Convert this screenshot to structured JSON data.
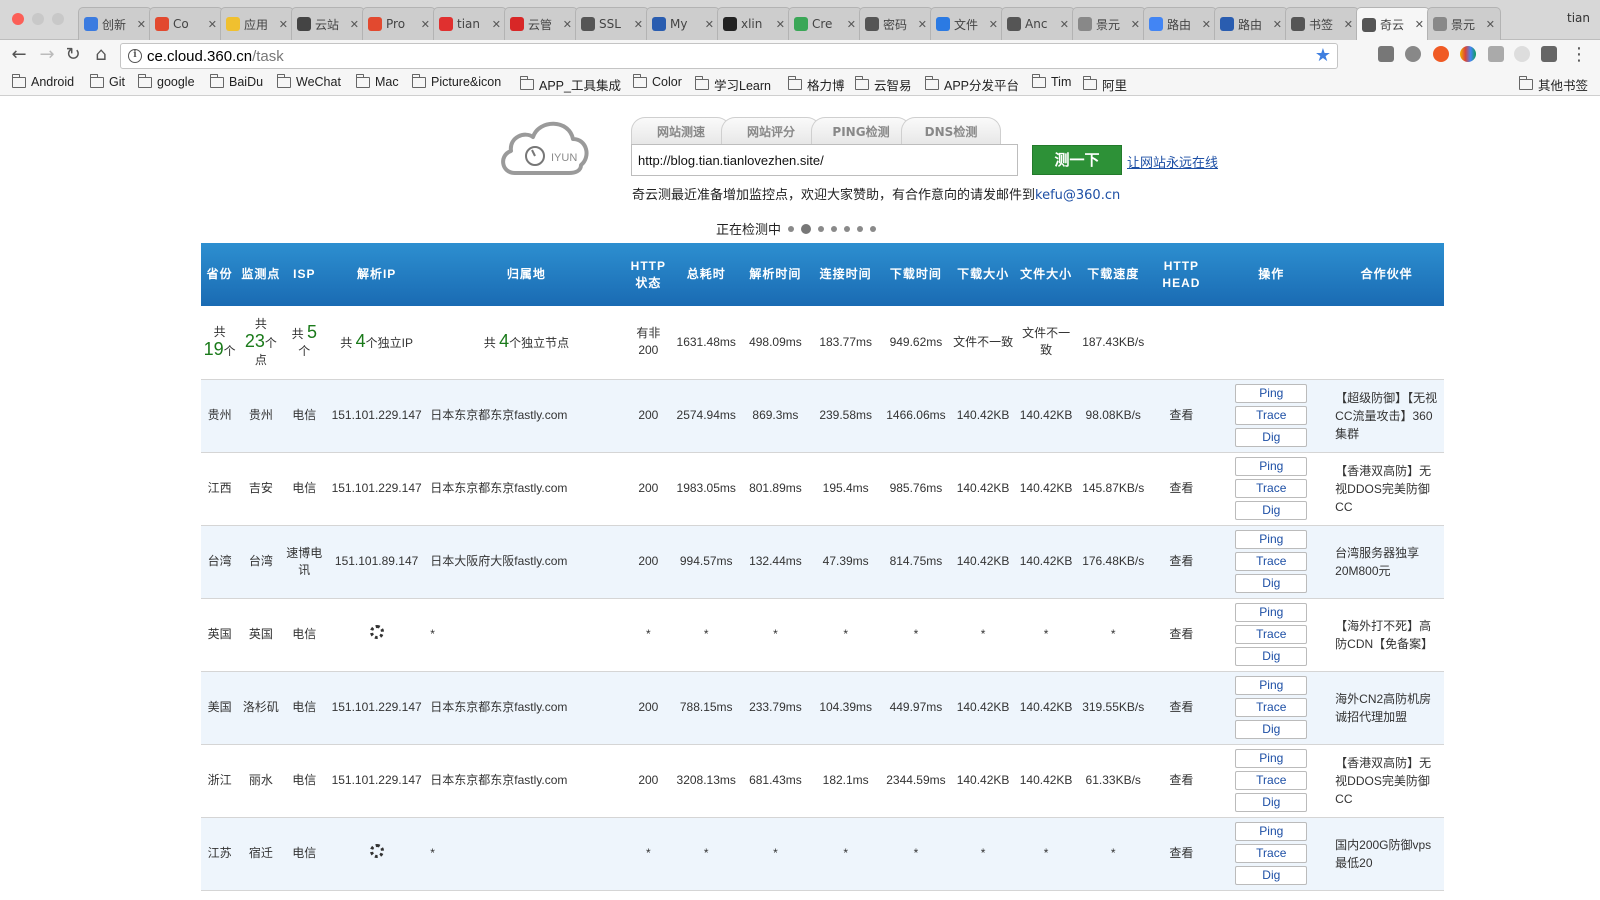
{
  "browser": {
    "tabs": [
      {
        "label": "创新",
        "color": "#3b7be0"
      },
      {
        "label": "Co",
        "color": "#e2492f"
      },
      {
        "label": "应用",
        "color": "#f0c02f"
      },
      {
        "label": "云站",
        "color": "#444444"
      },
      {
        "label": "Pro",
        "color": "#e2492f"
      },
      {
        "label": "tian",
        "color": "#e0302f"
      },
      {
        "label": "云管",
        "color": "#d82727"
      },
      {
        "label": "SSL",
        "color": "#555555"
      },
      {
        "label": "My",
        "color": "#2a5db0"
      },
      {
        "label": "xlin",
        "color": "#222222"
      },
      {
        "label": "Cre",
        "color": "#3aa757"
      },
      {
        "label": "密码",
        "color": "#555555"
      },
      {
        "label": "文件",
        "color": "#2b7ae3"
      },
      {
        "label": "Anc",
        "color": "#555555"
      },
      {
        "label": "景元",
        "color": "#888888"
      },
      {
        "label": "路由",
        "color": "#4285f4"
      },
      {
        "label": "路由",
        "color": "#2a5db0"
      },
      {
        "label": "书签",
        "color": "#555555"
      },
      {
        "label": "奇云",
        "color": "#555555"
      },
      {
        "label": "景元",
        "color": "#888888"
      }
    ],
    "active_tab_index": 18,
    "profile_name": "tian",
    "url_host": "ce.cloud.360.cn",
    "url_path": "/task",
    "bookmarks": [
      "Android",
      "Git",
      "google",
      "BaiDu",
      "WeChat",
      "Mac",
      "Picture&icon",
      "APP_工具集成",
      "Color",
      "学习Learn",
      "格力博",
      "云智易",
      "APP分发平台",
      "Tim",
      "阿里"
    ],
    "other_bookmarks": "其他书签"
  },
  "header": {
    "logo_text": "IYUN",
    "tabs": [
      "网站测速",
      "网站评分",
      "PING检测",
      "DNS检测"
    ],
    "url_value": "http://blog.tian.tianlovezhen.site/",
    "test_button": "测一下",
    "online_link": "让网站永远在线",
    "notice": "奇云测最近准备增加监控点，欢迎大家赞助，有合作意向的请发邮件到",
    "notice_email": "kefu@360.cn",
    "checking": "正在检测中"
  },
  "table": {
    "headers": [
      "省份",
      "监测点",
      "ISP",
      "解析IP",
      "归属地",
      "HTTP状态",
      "总耗时",
      "解析时间",
      "连接时间",
      "下载时间",
      "下载大小",
      "文件大小",
      "下载速度",
      "HTTP HEAD",
      "操作",
      "合作伙伴"
    ],
    "summary": {
      "province_count": "19",
      "province_unit": "个",
      "point_prefix": "共",
      "point_count": "23",
      "point_unit": "个点",
      "isp_count": "5",
      "isp_unit": "个",
      "ip_text": "共 4个独立IP",
      "ip_prefix": "共 ",
      "ip_num": "4",
      "ip_suffix": "个独立IP",
      "loc_prefix": "共 ",
      "loc_num": "4",
      "loc_suffix": "个独立节点",
      "http": "有非200",
      "total": "1631.48ms",
      "dns": "498.09ms",
      "connect": "183.77ms",
      "download": "949.62ms",
      "size": "文件不一致",
      "file": "文件不一致",
      "speed": "187.43KB/s"
    },
    "ops": [
      "Ping",
      "Trace",
      "Dig"
    ],
    "view": "查看",
    "rows": [
      {
        "province": "贵州",
        "point": "贵州",
        "isp": "电信",
        "ip": "151.101.229.147",
        "location": "日本东京都东京fastly.com",
        "http": "200",
        "total": "2574.94ms",
        "total_color": "red",
        "dns": "869.3ms",
        "connect": "239.58ms",
        "download": "1466.06ms",
        "size": "140.42KB",
        "file": "140.42KB",
        "speed": "98.08KB/s",
        "speed_color": "dgreen",
        "partner": "【超级防御】【无视CC流量攻击】360集群"
      },
      {
        "province": "江西",
        "point": "吉安",
        "isp": "电信",
        "ip": "151.101.229.147",
        "location": "日本东京都东京fastly.com",
        "http": "200",
        "total": "1983.05ms",
        "total_color": "orange",
        "dns": "801.89ms",
        "connect": "195.4ms",
        "download": "985.76ms",
        "size": "140.42KB",
        "file": "140.42KB",
        "speed": "145.87KB/s",
        "speed_color": "lgreen",
        "partner": "【香港双高防】无视DDOS完美防御CC"
      },
      {
        "province": "台湾",
        "point": "台湾",
        "isp": "速博电讯",
        "ip": "151.101.89.147",
        "location": "日本大阪府大阪fastly.com",
        "http": "200",
        "total": "994.57ms",
        "total_color": "lgreen",
        "dns": "132.44ms",
        "connect": "47.39ms",
        "download": "814.75ms",
        "size": "140.42KB",
        "file": "140.42KB",
        "speed": "176.48KB/s",
        "speed_color": "lgreen",
        "partner": "台湾服务器独享20M800元"
      },
      {
        "province": "英国",
        "point": "英国",
        "isp": "电信",
        "ip": "",
        "location": "*",
        "http": "*",
        "total": "*",
        "total_color": "",
        "dns": "*",
        "connect": "*",
        "download": "*",
        "size": "*",
        "file": "*",
        "speed": "*",
        "speed_color": "",
        "partner": "【海外打不死】高防CDN【免备案】",
        "loading": true
      },
      {
        "province": "美国",
        "point": "洛杉矶",
        "isp": "电信",
        "ip": "151.101.229.147",
        "location": "日本东京都东京fastly.com",
        "http": "200",
        "total": "788.15ms",
        "total_color": "lgreen",
        "dns": "233.79ms",
        "connect": "104.39ms",
        "download": "449.97ms",
        "size": "140.42KB",
        "file": "140.42KB",
        "speed": "319.55KB/s",
        "speed_color": "dgreen",
        "partner": "海外CN2高防机房诚招代理加盟"
      },
      {
        "province": "浙江",
        "point": "丽水",
        "isp": "电信",
        "ip": "151.101.229.147",
        "location": "日本东京都东京fastly.com",
        "http": "200",
        "total": "3208.13ms",
        "total_color": "red",
        "dns": "681.43ms",
        "connect": "182.1ms",
        "download": "2344.59ms",
        "size": "140.42KB",
        "file": "140.42KB",
        "speed": "61.33KB/s",
        "speed_color": "dgreen",
        "partner": "【香港双高防】无视DDOS完美防御CC"
      },
      {
        "province": "江苏",
        "point": "宿迁",
        "isp": "电信",
        "ip": "",
        "location": "*",
        "http": "*",
        "total": "*",
        "total_color": "",
        "dns": "*",
        "connect": "*",
        "download": "*",
        "size": "*",
        "file": "*",
        "speed": "*",
        "speed_color": "",
        "partner": "国内200G防御vps最低20",
        "loading": true
      }
    ]
  }
}
